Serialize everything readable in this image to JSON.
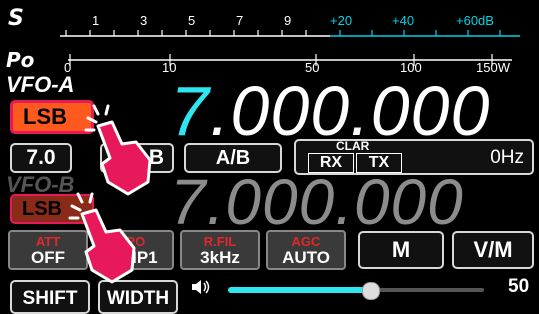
{
  "meter": {
    "s_label": "S",
    "s_ticks": [
      "1",
      "3",
      "5",
      "7",
      "9",
      "+20",
      "+40",
      "+60dB"
    ],
    "po_label": "Po",
    "po_ticks": [
      "0",
      "10",
      "50",
      "100",
      "150W"
    ]
  },
  "vfo_a": {
    "label": "VFO-A",
    "mode": "LSB",
    "freq_main": "7",
    "freq_rest": ".000.000"
  },
  "row2": {
    "step": "7.0",
    "partial": "B",
    "ab": "A/B",
    "clar": "CLAR",
    "rx": "RX",
    "tx": "TX",
    "offset": "0Hz"
  },
  "vfo_b": {
    "label": "VFO-B",
    "mode": "LSB",
    "freq": "7.000.000"
  },
  "function_buttons": [
    {
      "top": "ATT",
      "bottom": "OFF"
    },
    {
      "top": "IPO",
      "bottom": "AMP1"
    },
    {
      "top": "R.FIL",
      "bottom": "3kHz"
    },
    {
      "top": "AGC",
      "bottom": "AUTO"
    }
  ],
  "mem_button": "M",
  "vm_button": "V/M",
  "volume": {
    "value": "50",
    "level": 0.5
  },
  "bottom_buttons": [
    "SHIFT",
    "WIDTH"
  ],
  "colors": {
    "accent": "#e8195a",
    "freq_cyan": "#2ee6f0",
    "mode_orange": "#ff5a1e"
  }
}
